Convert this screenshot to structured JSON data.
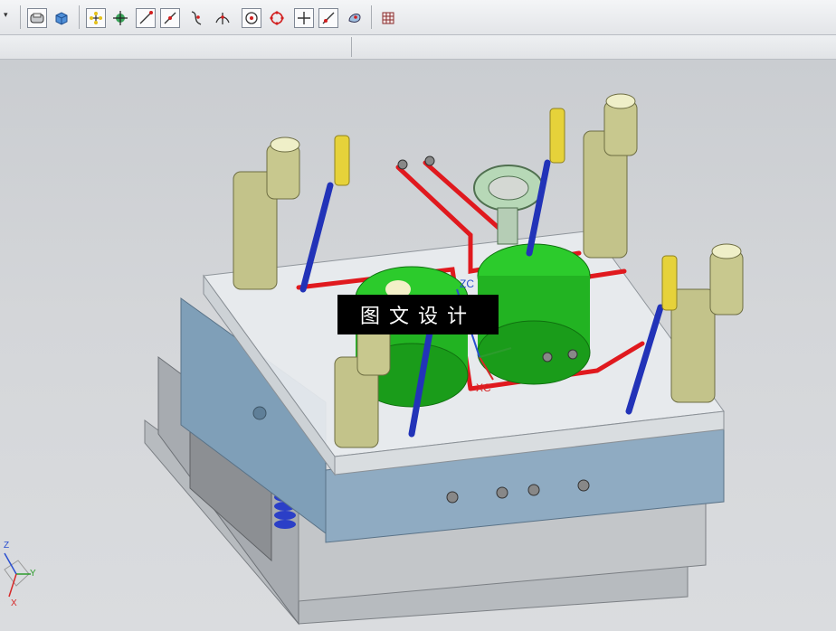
{
  "toolbar": {
    "dropdown_glyph": "▾",
    "icons": [
      "view-shaded-edges-icon",
      "view-shaded-icon",
      "snap-point-inference-icon",
      "snap-control-point-icon",
      "snap-endpoint-icon",
      "snap-midpoint-icon",
      "snap-curve-point-icon",
      "snap-intersection-icon",
      "snap-arc-center-icon",
      "snap-quadrant-icon",
      "snap-existing-point-icon",
      "snap-point-on-curve-icon",
      "snap-point-on-surface-icon",
      "grid-icon"
    ]
  },
  "viewport": {
    "watermark_text": "图文设计",
    "wcs_zc_label": "ZC",
    "wcs_xc_label": "XC",
    "triad": {
      "z": "Z",
      "y": "Y",
      "x": "X"
    }
  },
  "colors": {
    "toolbar_bg": "#e8eaed",
    "viewport_bg": "#d0d3d6",
    "mold_plate_blue": "#8aa7bf",
    "mold_base_gray": "#b9bcbf",
    "cavity_green": "#1fbf1f",
    "cooling_red": "#e0191e",
    "guide_pin_khaki": "#c9c98f",
    "return_pin_blue": "#2233b8",
    "bolt_yellow": "#e6d23a"
  }
}
